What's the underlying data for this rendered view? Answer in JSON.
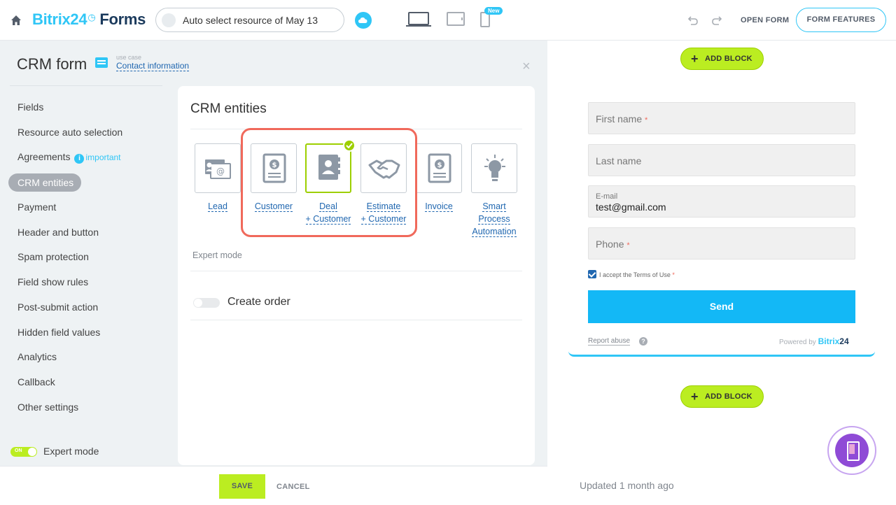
{
  "topbar": {
    "brand_name": "Bitrix24",
    "brand_product": "Forms",
    "form_title": "Auto select resource of May 13",
    "new_badge": "New",
    "open_form_label": "OPEN FORM",
    "form_features_label": "FORM FEATURES"
  },
  "panel": {
    "title": "CRM form",
    "usecase_label": "use case",
    "usecase_link": "Contact information"
  },
  "sidebar": {
    "items": [
      {
        "label": "Fields"
      },
      {
        "label": "Resource auto selection"
      },
      {
        "label": "Agreements"
      },
      {
        "label": "CRM entities"
      },
      {
        "label": "Payment"
      },
      {
        "label": "Header and button"
      },
      {
        "label": "Spam protection"
      },
      {
        "label": "Field show rules"
      },
      {
        "label": "Post-submit action"
      },
      {
        "label": "Hidden field values"
      },
      {
        "label": "Analytics"
      },
      {
        "label": "Callback"
      },
      {
        "label": "Other settings"
      }
    ],
    "important_label": "important",
    "expert_toggle_state": "ON",
    "expert_mode_label": "Expert mode"
  },
  "card": {
    "title": "CRM entities",
    "entities": [
      {
        "label": "Lead"
      },
      {
        "label": "Customer"
      },
      {
        "label": "Deal",
        "label2": "+ Customer"
      },
      {
        "label": "Estimate",
        "label2": "+ Customer"
      },
      {
        "label": "Invoice"
      },
      {
        "label": "Smart",
        "label2": "Process",
        "label3": "Automation"
      }
    ],
    "expert_mode_link": "Expert mode",
    "create_order_label": "Create order"
  },
  "bottom": {
    "save_label": "SAVE",
    "cancel_label": "CANCEL"
  },
  "preview": {
    "add_block_label": "ADD BLOCK",
    "fields": {
      "first_name": "First name",
      "last_name": "Last name",
      "email_label": "E-mail",
      "email_value": "test@gmail.com",
      "phone": "Phone",
      "required_mark": "*"
    },
    "terms_label": "I accept the Terms of Use",
    "send_label": "Send",
    "report_abuse": "Report abuse",
    "help_mark": "?",
    "powered_by": "Powered by",
    "powered_brand": "Bitrix",
    "powered_brand_num": "24",
    "updated": "Updated 1 month ago"
  },
  "colors": {
    "accent": "#2fc6f6",
    "green": "#bbed21",
    "selected_border": "#9dcf00",
    "highlight": "#f0695b",
    "link": "#2067b0"
  }
}
